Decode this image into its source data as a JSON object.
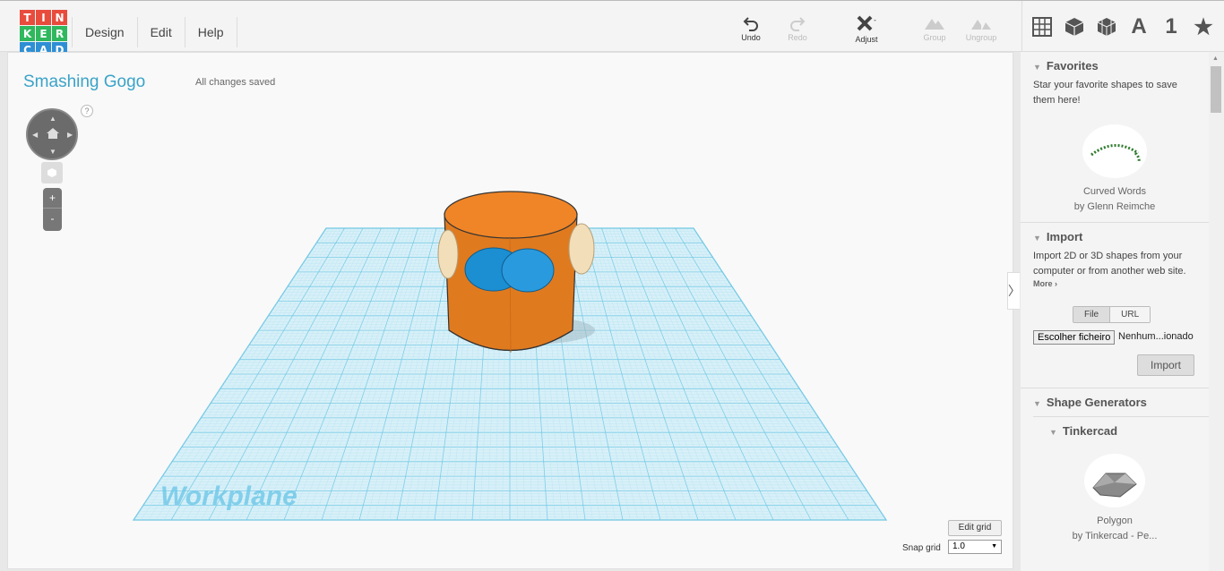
{
  "logo": {
    "letters": [
      "T",
      "I",
      "N",
      "K",
      "E",
      "R",
      "C",
      "A",
      "D"
    ],
    "colors": [
      "#e84c3d",
      "#e84c3d",
      "#e84c3d",
      "#2ecc71",
      "#2ecc71",
      "#2ecc71",
      "#3498db",
      "#3498db",
      "#3498db"
    ]
  },
  "menu": {
    "items": [
      "Design",
      "Edit",
      "Help"
    ]
  },
  "toolbar": {
    "undo": "Undo",
    "redo": "Redo",
    "adjust": "Adjust",
    "group": "Group",
    "ungroup": "Ungroup"
  },
  "view_icons": {
    "letter": "A",
    "number": "1",
    "star": "★"
  },
  "canvas": {
    "design_title": "Smashing Gogo",
    "save_status": "All changes saved",
    "help": "?",
    "zoom_in": "+",
    "zoom_out": "-",
    "workplane_label": "Workplane",
    "edit_grid": "Edit grid",
    "snap_label": "Snap grid",
    "snap_value": "1.0"
  },
  "sidebar": {
    "favorites": {
      "title": "Favorites",
      "text": "Star your favorite shapes to save them here!",
      "item_name": "Curved Words",
      "item_author": "by Glenn Reimche"
    },
    "import": {
      "title": "Import",
      "text": "Import 2D or 3D shapes from your computer or from another web site.",
      "more": "More ›",
      "tab_file": "File",
      "tab_url": "URL",
      "choose_file": "Escolher ficheiro",
      "no_file": "Nenhum...ionado",
      "button": "Import"
    },
    "shape_generators": {
      "title": "Shape Generators",
      "sub_title": "Tinkercad",
      "item_name": "Polygon",
      "item_author": "by Tinkercad - Pe..."
    }
  },
  "colors": {
    "accent": "#3aa3c8",
    "grid": "#7fcfea",
    "cylinder": "#e87d1e",
    "eyes": "#1f8fd0",
    "ears": "#f3e2c0"
  }
}
